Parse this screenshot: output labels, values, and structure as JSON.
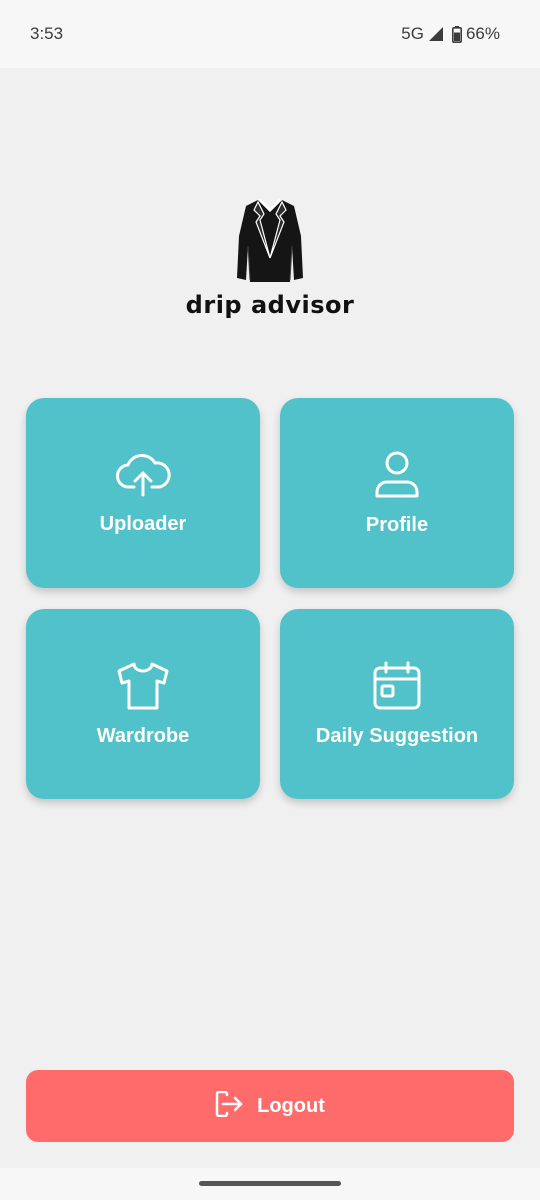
{
  "status_bar": {
    "time": "3:53",
    "network": "5G",
    "battery": "66%",
    "icons": [
      "signal-icon",
      "battery-icon"
    ]
  },
  "logo": {
    "icon": "blazer-icon",
    "text": "drip advisor"
  },
  "menu": {
    "tiles": [
      {
        "label": "Uploader",
        "icon": "cloud-upload-icon"
      },
      {
        "label": "Profile",
        "icon": "user-icon"
      },
      {
        "label": "Wardrobe",
        "icon": "tshirt-icon"
      },
      {
        "label": "Daily Suggestion",
        "icon": "calendar-icon"
      }
    ]
  },
  "logout": {
    "label": "Logout",
    "icon": "logout-icon"
  },
  "colors": {
    "background": "#f0f0f0",
    "tile": "#52c2ca",
    "logout": "#ff6b6b",
    "text_on_accent": "#ffffff"
  }
}
